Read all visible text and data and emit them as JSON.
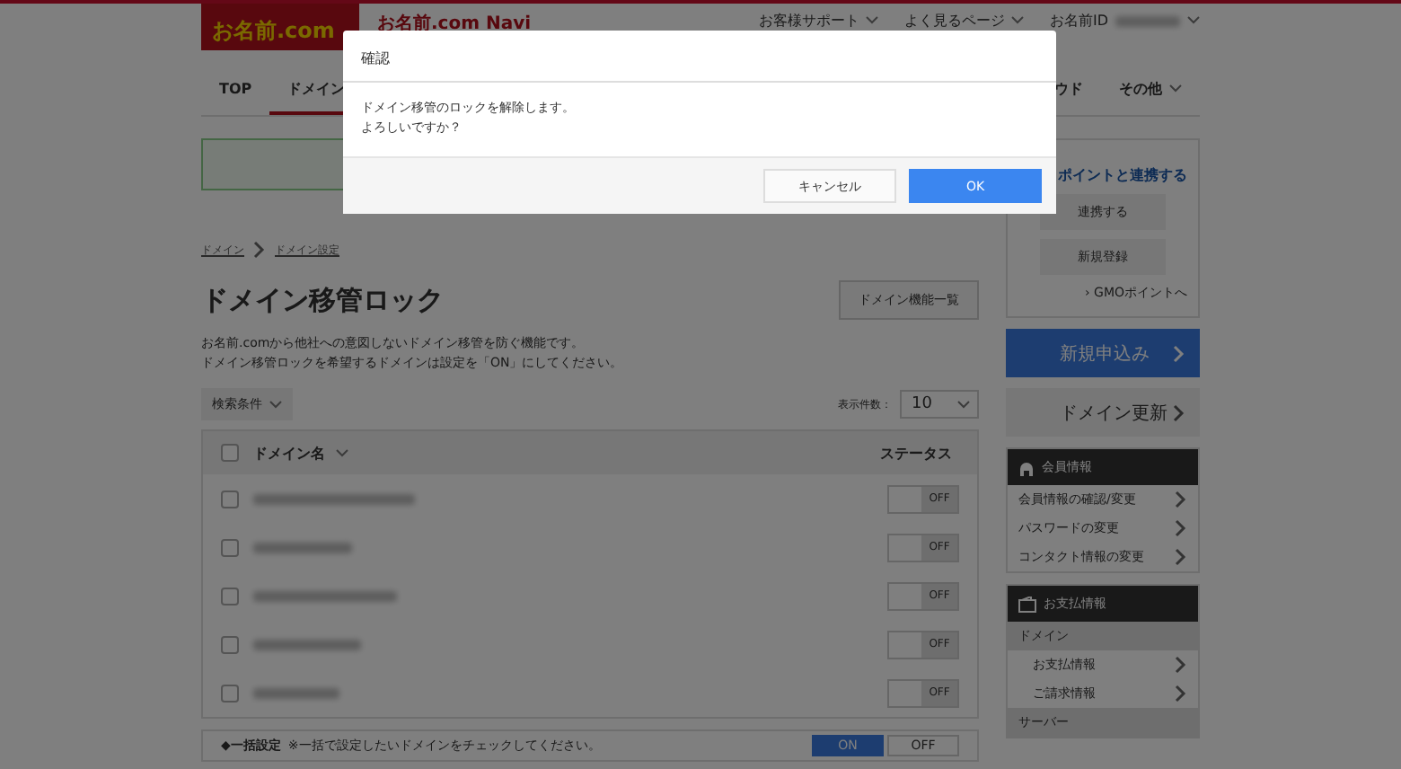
{
  "header": {
    "logo": "お名前.com",
    "site_title": "お名前.com Navi",
    "menus": [
      "お客様サポート",
      "よく見るページ"
    ],
    "account_label": "お名前ID"
  },
  "nav": [
    {
      "label": "TOP",
      "selected": false
    },
    {
      "label": "ドメイン",
      "selected": true
    },
    {
      "label": "ウド",
      "selected": false
    },
    {
      "label": "その他",
      "selected": false
    }
  ],
  "breadcrumb": [
    "ドメイン",
    "ドメイン設定"
  ],
  "page_title": "ドメイン移管ロック",
  "function_list_button": "ドメイン機能一覧",
  "description": [
    "お名前.comから他社への意図しないドメイン移管を防ぐ機能です。",
    "ドメイン移管ロックを希望するドメインは設定を「ON」にしてください。"
  ],
  "search_filter": "検索条件",
  "per_page": {
    "label": "表示件数：",
    "value": "10"
  },
  "table": {
    "select_all_checked": false,
    "columns": [
      "ドメイン名",
      "ステータス"
    ],
    "rows": [
      {
        "checked": false,
        "status": "OFF",
        "on": false
      },
      {
        "checked": false,
        "status": "OFF",
        "on": false
      },
      {
        "checked": false,
        "status": "OFF",
        "on": false
      },
      {
        "checked": false,
        "status": "OFF",
        "on": false
      },
      {
        "checked": false,
        "status": "OFF",
        "on": false
      }
    ]
  },
  "bulk": {
    "title": "◆一括設定",
    "note": "※一括で設定したいドメインをチェックしてください。",
    "buttons": [
      {
        "label": "ON",
        "selected": true
      },
      {
        "label": "OFF",
        "selected": false
      }
    ]
  },
  "sidebar": {
    "points": {
      "title": "ポイントと連携する",
      "buttons": [
        "連携する",
        "新規登録"
      ],
      "link": "› GMOポイントへ"
    },
    "actions": [
      {
        "label": "新規申込み",
        "kind": "primary"
      },
      {
        "label": "ドメイン更新",
        "kind": "secondary"
      }
    ],
    "panels": [
      {
        "title": "会員情報",
        "kind": "member",
        "groups": [
          {
            "items": [
              "会員情報の確認/変更",
              "パスワードの変更",
              "コンタクト情報の変更"
            ]
          }
        ]
      },
      {
        "title": "お支払情報",
        "kind": "payment",
        "groups": [
          {
            "heading": "ドメイン",
            "items": [
              "お支払情報",
              "ご請求情報"
            ]
          },
          {
            "heading": "サーバー"
          }
        ]
      }
    ]
  },
  "dialog": {
    "title": "確認",
    "message": [
      "ドメイン移管のロックを解除します。",
      "よろしいですか？"
    ],
    "buttons": [
      {
        "label": "キャンセル",
        "kind": "secondary"
      },
      {
        "label": "OK",
        "kind": "primary"
      }
    ]
  }
}
